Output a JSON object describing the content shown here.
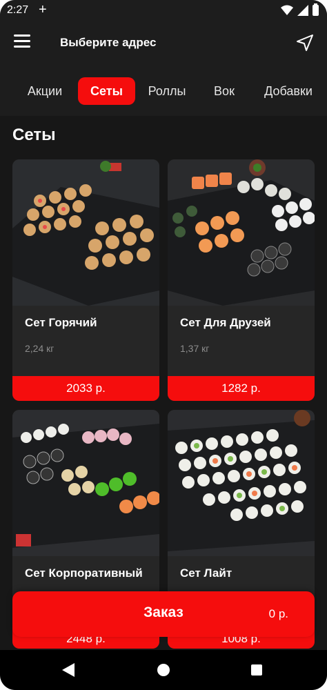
{
  "status_bar": {
    "time": "2:27",
    "plus": "+",
    "icons": [
      "wifi-icon",
      "signal-icon",
      "battery-icon"
    ]
  },
  "header": {
    "menu_icon": "menu-icon",
    "address_label": "Выберите адрес",
    "location_icon": "navigation-arrow-icon"
  },
  "tabs": [
    {
      "label": "Акции",
      "active": false
    },
    {
      "label": "Сеты",
      "active": true
    },
    {
      "label": "Роллы",
      "active": false
    },
    {
      "label": "Вок",
      "active": false
    },
    {
      "label": "Добавки",
      "active": false
    }
  ],
  "section": {
    "title": "Сеты"
  },
  "products": [
    {
      "name": "Сет Горячий",
      "weight": "2,24 кг",
      "price": "2033 р."
    },
    {
      "name": "Сет Для Друзей",
      "weight": "1,37 кг",
      "price": "1282 р."
    },
    {
      "name": "Сет Корпоративный",
      "weight": "",
      "price": "2448 р."
    },
    {
      "name": "Сет Лайт",
      "weight": "",
      "price": "1008 р."
    }
  ],
  "order": {
    "label": "Заказ",
    "total": "0 р."
  },
  "colors": {
    "accent": "#f50d0d",
    "background": "#171717",
    "card": "#262626"
  },
  "nav": {
    "icons": [
      "back-icon",
      "home-icon",
      "recent-apps-icon"
    ]
  }
}
